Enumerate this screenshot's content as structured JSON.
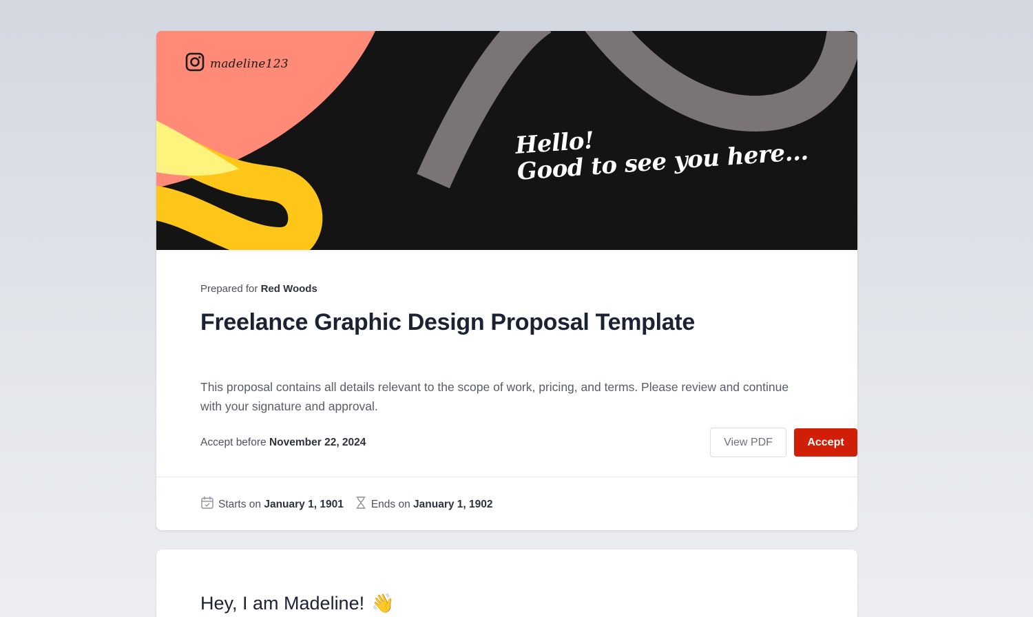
{
  "hero": {
    "instagram_icon": "instagram-icon",
    "handle": "madeline123",
    "greeting_line1": "Hello!",
    "greeting_line2": "Good to see you here...",
    "colors": {
      "background": "#141414",
      "coral": "#ff8a77",
      "yellow": "#ffc61a",
      "light_yellow": "#fdf784",
      "gray": "#7a7574"
    }
  },
  "proposal": {
    "prepared_prefix": "Prepared for",
    "client": "Red Woods",
    "title": "Freelance Graphic Design Proposal Template",
    "description": "This proposal contains all details relevant to the scope of work, pricing, and terms. Please review and continue with your signature and approval.",
    "deadline_prefix": "Accept before",
    "deadline": "November 22, 2024",
    "view_pdf_label": "View PDF",
    "accept_label": "Accept",
    "accent_color": "#d11f07"
  },
  "schedule": {
    "start_icon": "calendar-icon",
    "start_prefix": "Starts on",
    "start_date": "January 1, 1901",
    "end_icon": "hourglass-icon",
    "end_prefix": "Ends on",
    "end_date": "January 1, 1902"
  },
  "intro": {
    "heading": "Hey, I am Madeline!",
    "emoji": "👋",
    "emoji_icon": "waving-hand-icon"
  }
}
